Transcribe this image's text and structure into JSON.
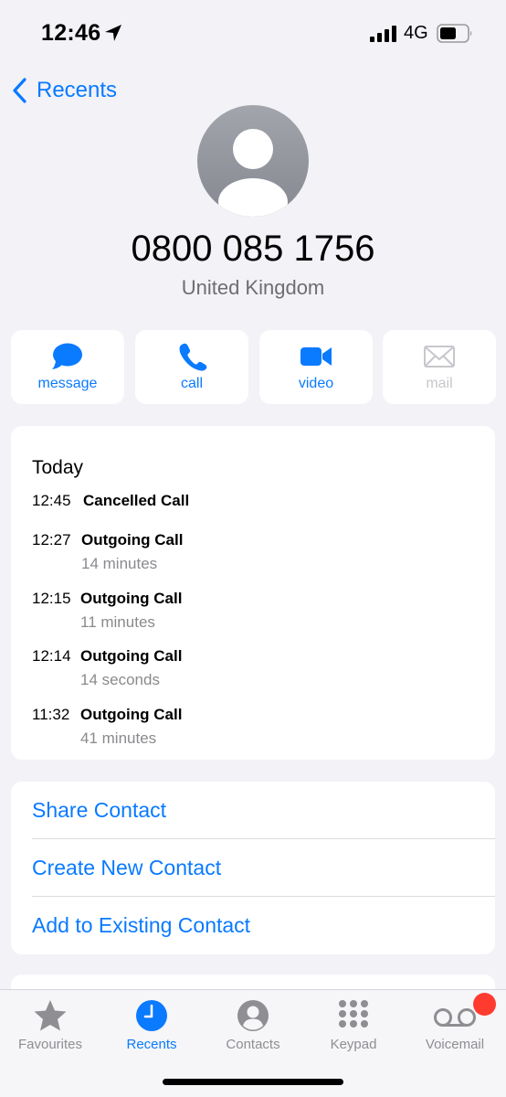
{
  "status_bar": {
    "time": "12:46",
    "network": "4G"
  },
  "nav": {
    "back_label": "Recents"
  },
  "contact": {
    "number": "0800 085 1756",
    "region": "United Kingdom"
  },
  "actions": [
    {
      "label": "message",
      "icon": "message-icon",
      "enabled": true
    },
    {
      "label": "call",
      "icon": "phone-icon",
      "enabled": true
    },
    {
      "label": "video",
      "icon": "video-icon",
      "enabled": true
    },
    {
      "label": "mail",
      "icon": "mail-icon",
      "enabled": false
    }
  ],
  "calls": {
    "heading": "Today",
    "items": [
      {
        "time": "12:45",
        "type": "Cancelled Call",
        "duration": ""
      },
      {
        "time": "12:27",
        "type": "Outgoing Call",
        "duration": "14 minutes"
      },
      {
        "time": "12:15",
        "type": "Outgoing Call",
        "duration": "11 minutes"
      },
      {
        "time": "12:14",
        "type": "Outgoing Call",
        "duration": "14 seconds"
      },
      {
        "time": "11:32",
        "type": "Outgoing Call",
        "duration": "41 minutes"
      }
    ]
  },
  "options": [
    {
      "label": "Share Contact"
    },
    {
      "label": "Create New Contact"
    },
    {
      "label": "Add to Existing Contact"
    }
  ],
  "tab_bar": {
    "tabs": [
      {
        "label": "Favourites",
        "icon": "star-icon",
        "active": false
      },
      {
        "label": "Recents",
        "icon": "clock-icon",
        "active": true
      },
      {
        "label": "Contacts",
        "icon": "person-circle-icon",
        "active": false
      },
      {
        "label": "Keypad",
        "icon": "keypad-icon",
        "active": false
      },
      {
        "label": "Voicemail",
        "icon": "voicemail-icon",
        "active": false
      }
    ]
  },
  "colors": {
    "accent": "#0a7aff",
    "background": "#f2f2f7",
    "secondary_text": "#8a8a8e",
    "badge": "#ff3b30"
  }
}
